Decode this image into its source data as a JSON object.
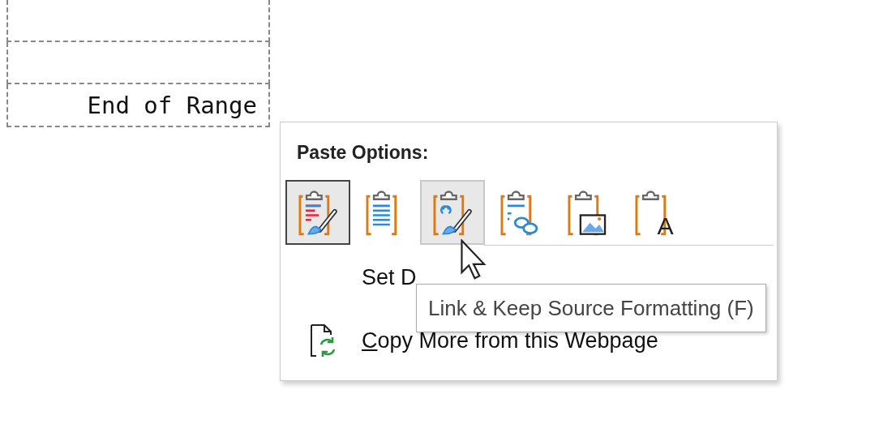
{
  "sheet": {
    "rows": [
      {
        "text": ""
      },
      {
        "text": ""
      },
      {
        "text": "End of Range"
      }
    ]
  },
  "context_menu": {
    "section_title": "Paste Options:",
    "paste_buttons": [
      {
        "kind": "keep-source",
        "selected": true,
        "hovered": false
      },
      {
        "kind": "merge",
        "selected": false,
        "hovered": false
      },
      {
        "kind": "link-keep",
        "selected": false,
        "hovered": true
      },
      {
        "kind": "link-merge",
        "selected": false,
        "hovered": false
      },
      {
        "kind": "picture",
        "selected": false,
        "hovered": false
      },
      {
        "kind": "text",
        "selected": false,
        "hovered": false,
        "glyph": "A"
      }
    ],
    "items": [
      {
        "kind": "plain",
        "label": "Set D"
      },
      {
        "kind": "copy-more",
        "label": "Copy More from this Webpage"
      }
    ]
  },
  "tooltip": {
    "text": "Link & Keep Source Formatting (F)"
  }
}
